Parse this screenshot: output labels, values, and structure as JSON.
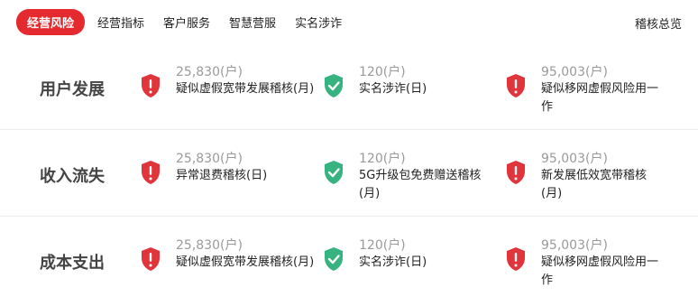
{
  "tabs": [
    {
      "label": "经营风险",
      "active": true
    },
    {
      "label": "经营指标",
      "active": false
    },
    {
      "label": "客户服务",
      "active": false
    },
    {
      "label": "智慧营服",
      "active": false
    },
    {
      "label": "实名涉诈",
      "active": false
    }
  ],
  "overview_label": "稽核总览",
  "colors": {
    "accent": "#e42a2e",
    "shield_red": "#e0353b",
    "shield_green": "#36b37e"
  },
  "rows": [
    {
      "title": "用户发展",
      "metrics": [
        {
          "value": "25,830(户)",
          "label": "疑似虚假宽带发展稽核(月)",
          "status": "alert"
        },
        {
          "value": "120(户)",
          "label": "实名涉诈(日)",
          "status": "ok"
        },
        {
          "value": "95,003(户)",
          "label": "疑似移网虚假风险用一作",
          "status": "alert"
        }
      ]
    },
    {
      "title": "收入流失",
      "metrics": [
        {
          "value": "25,830(户)",
          "label": "异常退费稽核(日)",
          "status": "alert"
        },
        {
          "value": "120(户)",
          "label": "5G升级包免费赠送稽核(月)",
          "status": "ok"
        },
        {
          "value": "95,003(户)",
          "label": "新发展低效宽带稽核(月)",
          "status": "alert"
        }
      ]
    },
    {
      "title": "成本支出",
      "metrics": [
        {
          "value": "25,830(户)",
          "label": "疑似虚假宽带发展稽核(月)",
          "status": "alert"
        },
        {
          "value": "120(户)",
          "label": "实名涉诈(日)",
          "status": "ok"
        },
        {
          "value": "95,003(户)",
          "label": "疑似移网虚假风险用一作",
          "status": "alert"
        }
      ]
    }
  ]
}
